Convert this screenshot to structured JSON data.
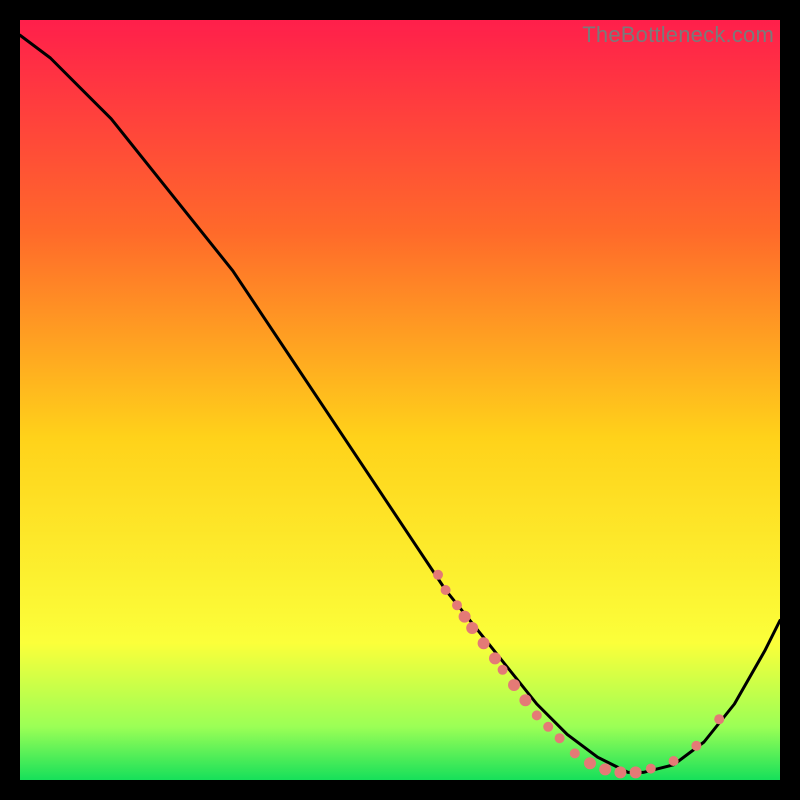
{
  "watermark": "TheBottleneck.com",
  "colors": {
    "gradient_top": "#ff1f4b",
    "gradient_mid_upper": "#ff6a2a",
    "gradient_mid": "#ffd21a",
    "gradient_lower": "#fbff3a",
    "gradient_bottom_band": "#9bff56",
    "gradient_bottom": "#16e05a",
    "curve": "#000000",
    "dots": "#e47a76",
    "frame_bg": "#000000"
  },
  "chart_data": {
    "type": "line",
    "title": "",
    "xlabel": "",
    "ylabel": "",
    "xlim": [
      0,
      100
    ],
    "ylim": [
      0,
      100
    ],
    "curve": {
      "x": [
        0,
        4,
        8,
        12,
        16,
        20,
        24,
        28,
        32,
        36,
        40,
        44,
        48,
        52,
        56,
        60,
        64,
        68,
        72,
        76,
        80,
        82,
        86,
        90,
        94,
        98,
        100
      ],
      "y": [
        98,
        95,
        91,
        87,
        82,
        77,
        72,
        67,
        61,
        55,
        49,
        43,
        37,
        31,
        25,
        20,
        15,
        10,
        6,
        3,
        1,
        1,
        2,
        5,
        10,
        17,
        21
      ]
    },
    "dots": [
      {
        "x": 55,
        "y": 27,
        "r": 5
      },
      {
        "x": 56,
        "y": 25,
        "r": 5
      },
      {
        "x": 57.5,
        "y": 23,
        "r": 5
      },
      {
        "x": 58.5,
        "y": 21.5,
        "r": 6
      },
      {
        "x": 59.5,
        "y": 20,
        "r": 6
      },
      {
        "x": 61,
        "y": 18,
        "r": 6
      },
      {
        "x": 62.5,
        "y": 16,
        "r": 6
      },
      {
        "x": 63.5,
        "y": 14.5,
        "r": 5
      },
      {
        "x": 65,
        "y": 12.5,
        "r": 6
      },
      {
        "x": 66.5,
        "y": 10.5,
        "r": 6
      },
      {
        "x": 68,
        "y": 8.5,
        "r": 5
      },
      {
        "x": 69.5,
        "y": 7,
        "r": 5
      },
      {
        "x": 71,
        "y": 5.5,
        "r": 5
      },
      {
        "x": 73,
        "y": 3.5,
        "r": 5
      },
      {
        "x": 75,
        "y": 2.2,
        "r": 6
      },
      {
        "x": 77,
        "y": 1.4,
        "r": 6
      },
      {
        "x": 79,
        "y": 1.0,
        "r": 6
      },
      {
        "x": 81,
        "y": 1.0,
        "r": 6
      },
      {
        "x": 83,
        "y": 1.5,
        "r": 5
      },
      {
        "x": 86,
        "y": 2.5,
        "r": 5
      },
      {
        "x": 89,
        "y": 4.5,
        "r": 5
      },
      {
        "x": 92,
        "y": 8,
        "r": 5
      }
    ]
  }
}
